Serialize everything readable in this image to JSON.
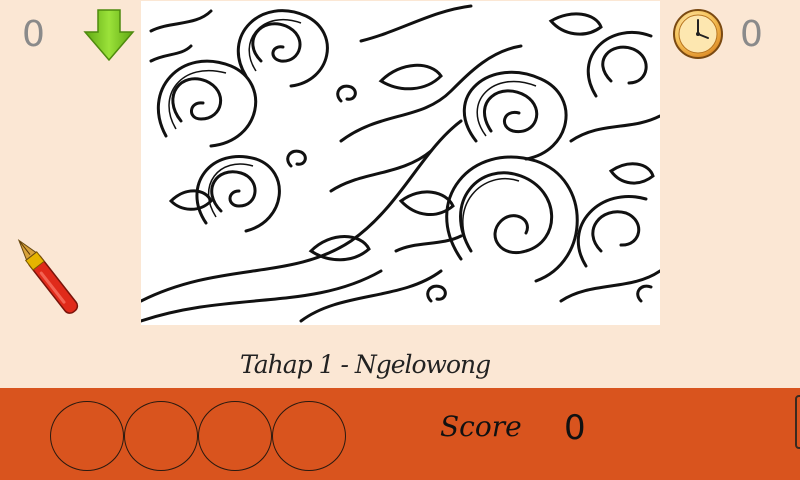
{
  "hud": {
    "left_counter": "0",
    "right_counter": "0",
    "arrow_icon": "down-arrow-icon",
    "clock_icon": "clock-icon"
  },
  "stage": {
    "title": "Tahap 1 - Ngelowong"
  },
  "tools": {
    "pen_icon": "pen-icon"
  },
  "bottom_bar": {
    "score_label": "Score",
    "score_value": "0",
    "slot_count": 4
  },
  "colors": {
    "background": "#fbe7d4",
    "bar": "#d9541e",
    "arrow": "#7cc21a",
    "clock": "#e8a23a"
  }
}
